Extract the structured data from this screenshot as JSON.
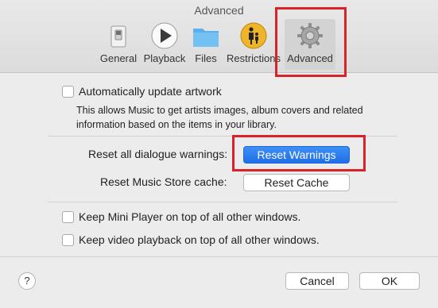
{
  "window": {
    "title": "Advanced"
  },
  "toolbar": {
    "tabs": [
      {
        "label": "General",
        "icon": "general-switch-icon"
      },
      {
        "label": "Playback",
        "icon": "play-icon"
      },
      {
        "label": "Files",
        "icon": "folder-icon"
      },
      {
        "label": "Restrictions",
        "icon": "parental-restriction-icon"
      },
      {
        "label": "Advanced",
        "icon": "gear-icon",
        "selected": true
      }
    ]
  },
  "artwork": {
    "checkbox_label": "Automatically update artwork",
    "checked": false,
    "description_line1": "This allows Music to get artists images, album covers and related",
    "description_line2": "information based on the items in your library."
  },
  "resets": {
    "dialogue_label": "Reset all dialogue warnings:",
    "dialogue_button": "Reset Warnings",
    "cache_label": "Reset Music Store cache:",
    "cache_button": "Reset Cache"
  },
  "options": {
    "mini_player_label": "Keep Mini Player on top of all other windows.",
    "mini_player_checked": false,
    "video_label": "Keep video playback on top of all other windows.",
    "video_checked": false
  },
  "footer": {
    "help_label": "?",
    "cancel_label": "Cancel",
    "ok_label": "OK"
  },
  "colors": {
    "highlight": "#d9222a",
    "primary_button": "#2a7cf0"
  }
}
